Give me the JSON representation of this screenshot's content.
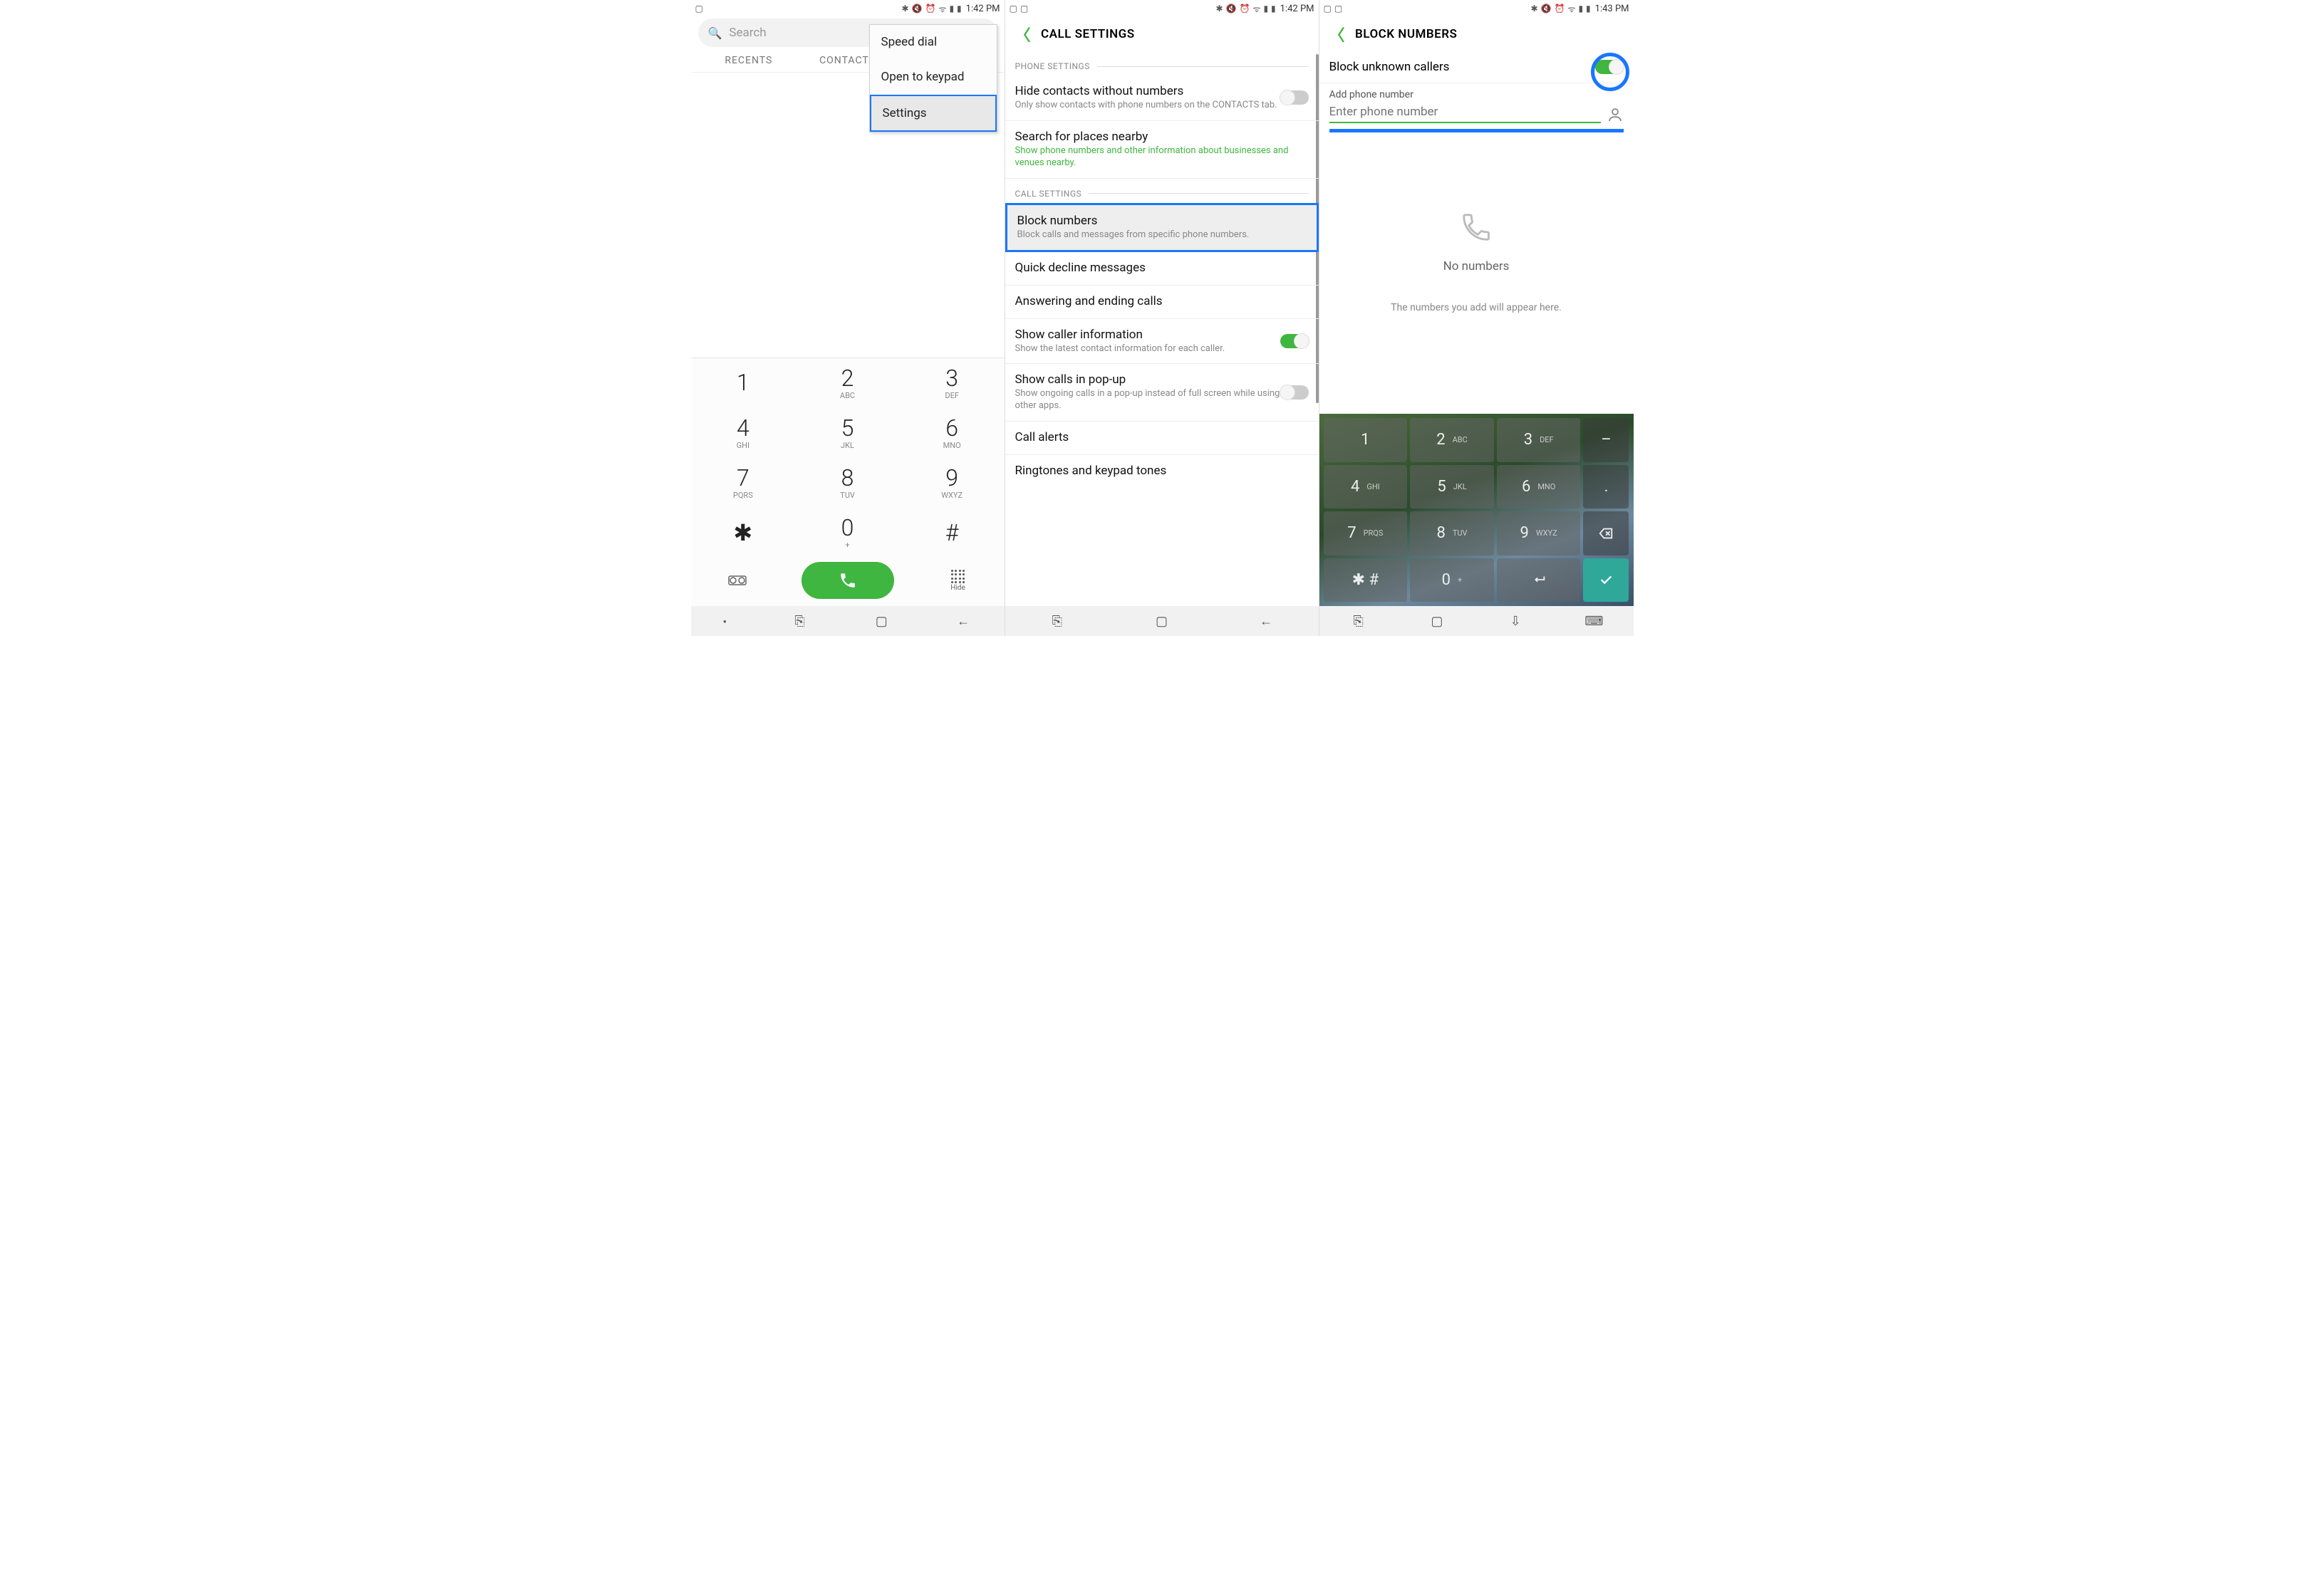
{
  "status": {
    "left_icons": [
      "image-icon",
      "sim-icon"
    ],
    "right_icons": [
      "bluetooth",
      "mute",
      "alarm",
      "wifi",
      "signal",
      "battery"
    ],
    "time_a": "1:42 PM",
    "time_b": "1:42 PM",
    "time_c": "1:43 PM"
  },
  "screen1": {
    "search_placeholder": "Search",
    "tabs": {
      "recents": "RECENTS",
      "contacts": "CONTACTS"
    },
    "menu": {
      "speed_dial": "Speed dial",
      "open_keypad": "Open to keypad",
      "settings": "Settings"
    },
    "dialpad": {
      "k1": {
        "d": "1",
        "l": ""
      },
      "k2": {
        "d": "2",
        "l": "ABC"
      },
      "k3": {
        "d": "3",
        "l": "DEF"
      },
      "k4": {
        "d": "4",
        "l": "GHI"
      },
      "k5": {
        "d": "5",
        "l": "JKL"
      },
      "k6": {
        "d": "6",
        "l": "MNO"
      },
      "k7": {
        "d": "7",
        "l": "PQRS"
      },
      "k8": {
        "d": "8",
        "l": "TUV"
      },
      "k9": {
        "d": "9",
        "l": "WXYZ"
      },
      "kst": {
        "d": "✱",
        "l": ""
      },
      "k0": {
        "d": "0",
        "l": "+"
      },
      "khs": {
        "d": "#",
        "l": ""
      }
    },
    "hide_label": "Hide"
  },
  "screen2": {
    "title": "CALL SETTINGS",
    "section_phone": "PHONE SETTINGS",
    "hide_contacts": {
      "t": "Hide contacts without numbers",
      "s": "Only show contacts with phone numbers on the CONTACTS tab."
    },
    "search_places": {
      "t": "Search for places nearby",
      "s": "Show phone numbers and other information about businesses and venues nearby."
    },
    "section_call": "CALL SETTINGS",
    "block_numbers": {
      "t": "Block numbers",
      "s": "Block calls and messages from specific phone numbers."
    },
    "quick_decline": {
      "t": "Quick decline messages"
    },
    "answer_end": {
      "t": "Answering and ending calls"
    },
    "caller_info": {
      "t": "Show caller information",
      "s": "Show the latest contact information for each caller."
    },
    "popup": {
      "t": "Show calls in pop-up",
      "s": "Show ongoing calls in a pop-up instead of full screen while using other apps."
    },
    "alerts": {
      "t": "Call alerts"
    },
    "ringtones": {
      "t": "Ringtones and keypad tones"
    }
  },
  "screen3": {
    "title": "BLOCK NUMBERS",
    "block_unknown": "Block unknown callers",
    "add_label": "Add phone number",
    "input_placeholder": "Enter phone number",
    "no_numbers": "No numbers",
    "hint": "The numbers you add will appear here.",
    "kbd": {
      "k1": {
        "d": "1",
        "l": ""
      },
      "k2": {
        "d": "2",
        "l": "ABC"
      },
      "k3": {
        "d": "3",
        "l": "DEF"
      },
      "k4": {
        "d": "4",
        "l": "GHI"
      },
      "k5": {
        "d": "5",
        "l": "JKL"
      },
      "k6": {
        "d": "6",
        "l": "MNO"
      },
      "k7": {
        "d": "7",
        "l": "PRQS"
      },
      "k8": {
        "d": "8",
        "l": "TUV"
      },
      "k9": {
        "d": "9",
        "l": "WXYZ"
      },
      "kst": {
        "d": "✱ #",
        "l": ""
      },
      "k0": {
        "d": "0",
        "l": "+"
      },
      "minus": "–",
      "period": ".",
      "delete": "⌫",
      "return": "↵",
      "done": "✓"
    }
  }
}
